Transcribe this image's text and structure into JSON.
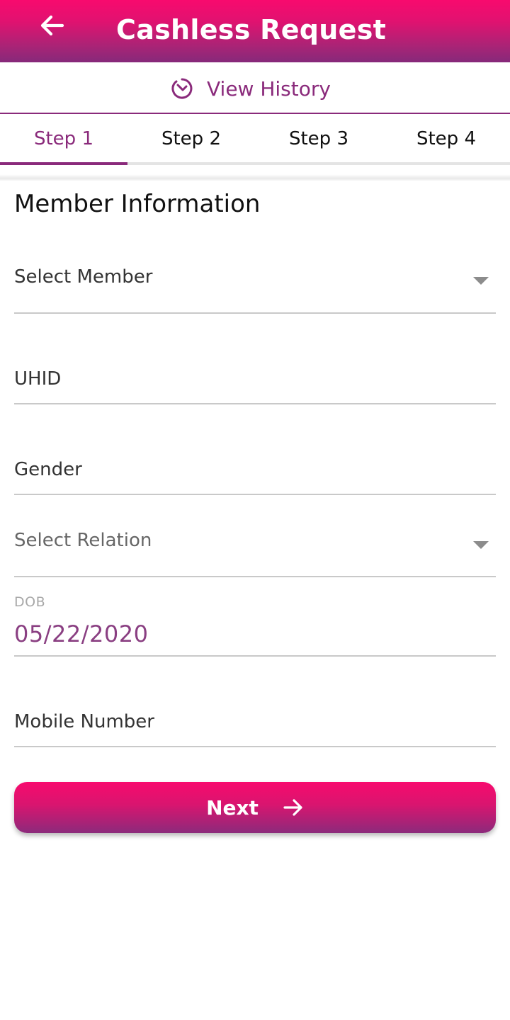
{
  "header": {
    "title": "Cashless Request",
    "back_icon": "arrow-left-icon",
    "background_colors": [
      "#f80a6e",
      "#86297a"
    ]
  },
  "history": {
    "label": "View History",
    "icon": "history-clock-icon",
    "color": "#8a2a7b"
  },
  "tabs": [
    {
      "label": "Step 1",
      "active": true
    },
    {
      "label": "Step 2",
      "active": false
    },
    {
      "label": "Step 3",
      "active": false
    },
    {
      "label": "Step 4",
      "active": false
    }
  ],
  "form": {
    "section_title": "Member Information",
    "fields": {
      "member": {
        "label": "Select Member",
        "icon": "dropdown-arrow-icon"
      },
      "uhid": {
        "label": "UHID"
      },
      "gender": {
        "label": "Gender"
      },
      "relation": {
        "label": "Select Relation",
        "icon": "dropdown-arrow-icon"
      },
      "dob": {
        "label": "DOB",
        "value": "05/22/2020"
      },
      "mobile": {
        "label": "Mobile Number"
      }
    }
  },
  "next_button": {
    "label": "Next",
    "icon": "arrow-right-icon"
  },
  "colors": {
    "accent": "#8a2a7b",
    "primary_pink": "#f80a6e"
  }
}
